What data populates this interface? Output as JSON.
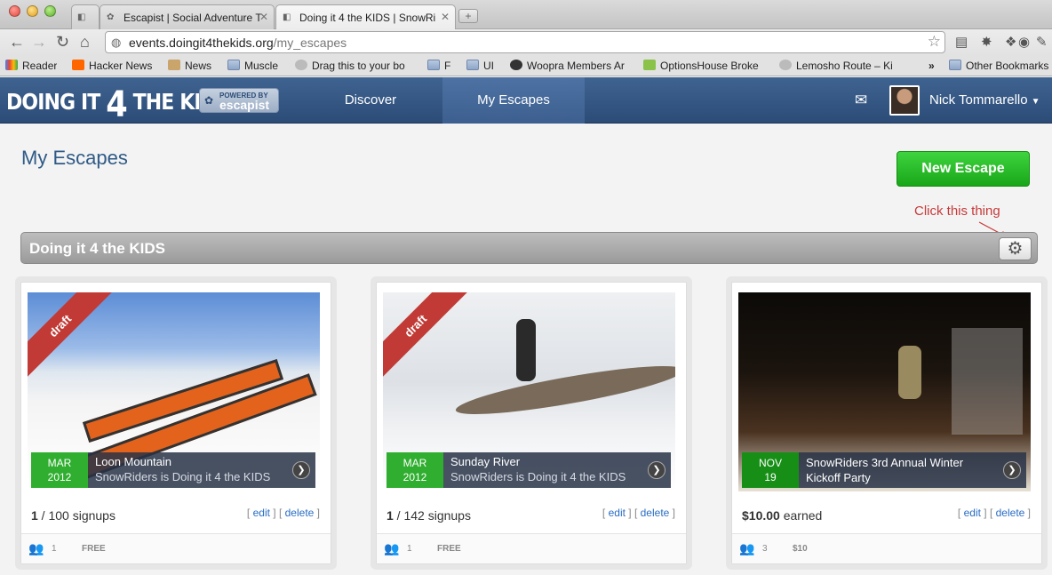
{
  "browser": {
    "tabs": [
      {
        "label": ""
      },
      {
        "label": "Escapist | Social Adventure T"
      },
      {
        "label": "Doing it 4 the KIDS | SnowRi"
      }
    ],
    "url_domain": "events.doingit4thekids.org",
    "url_path": "/my_escapes",
    "bookmarks": [
      {
        "label": "Reader"
      },
      {
        "label": "Hacker News"
      },
      {
        "label": "News"
      },
      {
        "label": "Muscle"
      },
      {
        "label": "Drag this to your bo"
      },
      {
        "label": "F"
      },
      {
        "label": "UI"
      },
      {
        "label": "Woopra Members Ar"
      },
      {
        "label": "OptionsHouse Broke"
      },
      {
        "label": "Lemosho Route – Ki"
      },
      {
        "label": "Other Bookmarks"
      }
    ],
    "bookmarks_overflow": "»"
  },
  "site": {
    "logo_part1": "DOING IT ",
    "logo_four": "4",
    "logo_part2": " THE KIDS",
    "powered_by": "POWERED BY",
    "powered_brand": "escapist",
    "nav": [
      {
        "label": "Discover"
      },
      {
        "label": "My Escapes"
      }
    ],
    "user_name": "Nick Tommarello"
  },
  "main": {
    "title": "My Escapes",
    "new_button": "New Escape",
    "annotation": "Click this thing",
    "group_title": "Doing it 4 the KIDS",
    "edit_label": "edit",
    "delete_label": "delete",
    "cards": [
      {
        "badge": "draft",
        "month": "MAR",
        "year": "2012",
        "name": "Loon Mountain",
        "subtitle": "SnowRiders is Doing it 4 the KIDS",
        "stat_value": "1",
        "stat_rest": " / 100 signups",
        "people": "1",
        "price": "FREE"
      },
      {
        "badge": "draft",
        "month": "MAR",
        "year": "2012",
        "name": "Sunday River",
        "subtitle": "SnowRiders is Doing it 4 the KIDS",
        "stat_value": "1",
        "stat_rest": " / 142 signups",
        "people": "1",
        "price": "FREE"
      },
      {
        "month": "NOV",
        "year": "19",
        "name": "SnowRiders 3rd Annual Winter Kickoff Party",
        "stat_value": "$10.00",
        "stat_rest": " earned",
        "people": "3",
        "price": "$10"
      }
    ]
  },
  "colors": {
    "header": "#2c4c77",
    "accent_green": "#18a618",
    "draft_red": "#c13a36",
    "annotation_red": "#c83a3a"
  },
  "icons": [
    "back-icon",
    "forward-icon",
    "reload-icon",
    "home-icon",
    "globe-icon",
    "star-icon",
    "gear-icon",
    "envelope-icon",
    "chevron-right-icon",
    "people-icon"
  ]
}
